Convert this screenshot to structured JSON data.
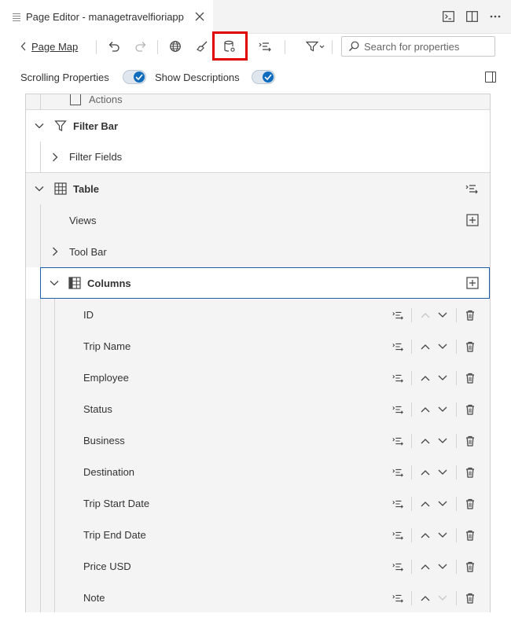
{
  "tab": {
    "title": "Page Editor - managetravelfioriapp"
  },
  "toolbar": {
    "page_map_label": "Page Map",
    "search_placeholder": "Search for properties"
  },
  "toggles": {
    "scrolling_label": "Scrolling Properties",
    "scrolling_on": true,
    "descriptions_label": "Show Descriptions",
    "descriptions_on": true
  },
  "tree": {
    "actions_label": "Actions",
    "filter_bar_label": "Filter Bar",
    "filter_fields_label": "Filter Fields",
    "table_label": "Table",
    "views_label": "Views",
    "tool_bar_label": "Tool Bar",
    "columns_label": "Columns",
    "columns": [
      {
        "label": "ID"
      },
      {
        "label": "Trip Name"
      },
      {
        "label": "Employee"
      },
      {
        "label": "Status"
      },
      {
        "label": "Business"
      },
      {
        "label": "Destination"
      },
      {
        "label": "Trip Start Date"
      },
      {
        "label": "Trip End Date"
      },
      {
        "label": "Price USD"
      },
      {
        "label": "Note"
      }
    ]
  },
  "colors": {
    "accent": "#0f6cbd",
    "highlight": "#e00000",
    "selection": "#1f5faa"
  }
}
